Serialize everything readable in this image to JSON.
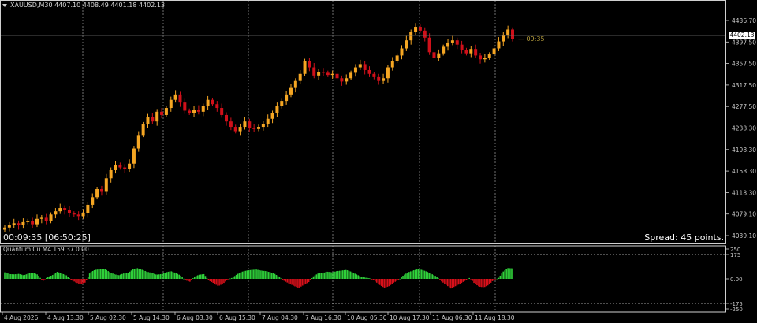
{
  "header": {
    "symbol_label": "XAUUSD,M30",
    "ohlc_text": "4407.10 4408.49 4401.18 4402.13"
  },
  "price_axis": {
    "ticks": [
      "4436.70",
      "4397.50",
      "4357.50",
      "4317.50",
      "4277.50",
      "4238.30",
      "4198.30",
      "4158.30",
      "4118.30",
      "4079.10",
      "4039.10"
    ],
    "bid_label": "4402.13"
  },
  "candle_countdown": "— 09:35",
  "timer_text": "00:09:35 [06:50:25]",
  "spread_text": "Spread: 45 points.",
  "indicator": {
    "name": "Quantum Cu M4 159.37 0.00",
    "levels": [
      "250",
      "175",
      "0.00",
      "-175",
      "-250"
    ]
  },
  "time_axis": [
    "4 Aug 2026",
    "4 Aug 13:30",
    "5 Aug 02:30",
    "5 Aug 14:30",
    "6 Aug 03:30",
    "6 Aug 15:30",
    "7 Aug 04:30",
    "7 Aug 16:30",
    "10 Aug 05:30",
    "10 Aug 17:30",
    "11 Aug 06:30",
    "11 Aug 18:30"
  ],
  "colors": {
    "background": "#000000",
    "bull": "#f5a623",
    "bear": "#d0101a",
    "bid_line": "#707070",
    "hist_pos": "#2fd03a",
    "hist_neg": "#d8101a",
    "grid": "#a0a0a0"
  },
  "chart_data": {
    "type": "candlestick",
    "title": "XAUUSD,M30",
    "ylim": [
      4039.1,
      4436.7
    ],
    "close_series": [
      4054,
      4058,
      4062,
      4058,
      4064,
      4066,
      4060,
      4070,
      4072,
      4066,
      4078,
      4084,
      4090,
      4086,
      4080,
      4078,
      4075,
      4080,
      4096,
      4110,
      4125,
      4120,
      4145,
      4160,
      4170,
      4165,
      4162,
      4172,
      4200,
      4225,
      4245,
      4258,
      4250,
      4268,
      4262,
      4275,
      4290,
      4300,
      4285,
      4270,
      4266,
      4272,
      4268,
      4278,
      4290,
      4282,
      4275,
      4262,
      4250,
      4240,
      4232,
      4240,
      4250,
      4238,
      4236,
      4240,
      4245,
      4255,
      4265,
      4278,
      4288,
      4300,
      4312,
      4325,
      4338,
      4362,
      4350,
      4335,
      4342,
      4340,
      4336,
      4338,
      4330,
      4324,
      4330,
      4340,
      4350,
      4356,
      4345,
      4338,
      4332,
      4325,
      4330,
      4350,
      4362,
      4372,
      4385,
      4400,
      4415,
      4425,
      4418,
      4405,
      4378,
      4368,
      4376,
      4388,
      4396,
      4400,
      4392,
      4382,
      4376,
      4384,
      4372,
      4365,
      4368,
      4374,
      4385,
      4398,
      4410,
      4420,
      4402
    ],
    "indicator_values": [
      55,
      40,
      38,
      42,
      30,
      45,
      50,
      35,
      -20,
      15,
      30,
      60,
      45,
      30,
      -8,
      -30,
      -45,
      -30,
      55,
      75,
      80,
      85,
      60,
      40,
      30,
      45,
      50,
      80,
      90,
      75,
      60,
      50,
      35,
      40,
      55,
      65,
      50,
      30,
      -10,
      -25,
      20,
      35,
      40,
      -15,
      -35,
      -60,
      -40,
      -5,
      10,
      40,
      60,
      70,
      75,
      78,
      70,
      65,
      55,
      40,
      10,
      -20,
      -40,
      -60,
      -75,
      -50,
      -30,
      20,
      45,
      50,
      60,
      55,
      65,
      70,
      75,
      60,
      40,
      20,
      10,
      5,
      -20,
      -50,
      -75,
      -60,
      -30,
      -10,
      30,
      55,
      70,
      80,
      75,
      60,
      40,
      20,
      -20,
      -50,
      -80,
      -60,
      -40,
      -15,
      10,
      -40,
      -65,
      -70,
      -50,
      -10,
      5,
      60,
      90,
      88
    ]
  }
}
